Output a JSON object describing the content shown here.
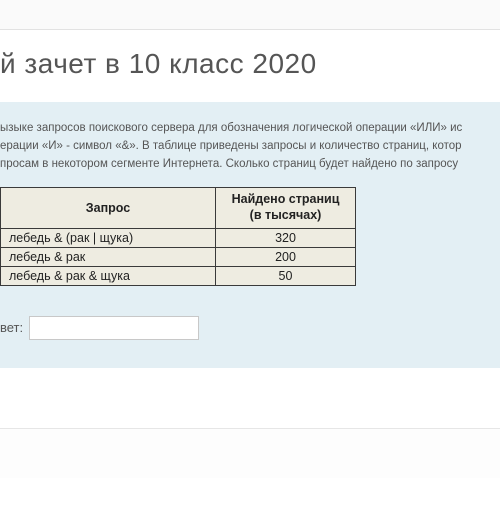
{
  "page": {
    "title": "й зачет в 10 класс 2020"
  },
  "question": {
    "line1": "ызыке запросов поискового сервера для обозначения логической операции «ИЛИ» ис",
    "line2": "ерации «И» - символ «&». В таблице приведены запросы и количество страниц, котор",
    "line3": "просам в некотором сегменте Интернета.    Сколько страниц будет найдено по запросу"
  },
  "table": {
    "headers": {
      "query": "Запрос",
      "found": "Найдено страниц (в тысячах)"
    },
    "rows": [
      {
        "query": "лебедь & (рак | щука)",
        "found": "320"
      },
      {
        "query": "лебедь & рак",
        "found": "200"
      },
      {
        "query": "лебедь & рак & щука",
        "found": "50"
      }
    ]
  },
  "answer": {
    "label": "вет:",
    "value": ""
  }
}
